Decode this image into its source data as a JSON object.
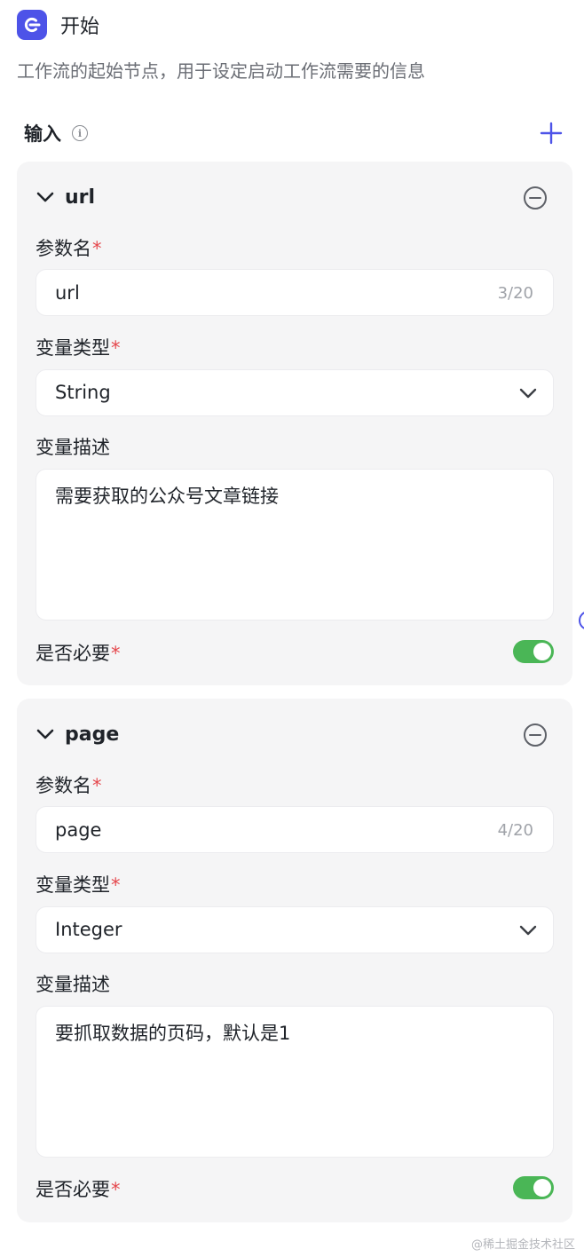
{
  "header": {
    "title": "开始",
    "logo_icon": "start-node-icon",
    "logo_color": "#4d53e8"
  },
  "description": "工作流的起始节点，用于设定启动工作流需要的信息",
  "inputs": {
    "label": "输入",
    "info_icon": "i",
    "add_icon": "plus-icon"
  },
  "params": [
    {
      "name": "url",
      "name_label": "参数名",
      "name_value": "url",
      "name_counter": "3/20",
      "type_label": "变量类型",
      "type_value": "String",
      "desc_label": "变量描述",
      "desc_value": "需要获取的公众号文章链接",
      "required_label": "是否必要",
      "required": true
    },
    {
      "name": "page",
      "name_label": "参数名",
      "name_value": "page",
      "name_counter": "4/20",
      "type_label": "变量类型",
      "type_value": "Integer",
      "desc_label": "变量描述",
      "desc_value": "要抓取数据的页码，默认是1",
      "required_label": "是否必要",
      "required": true
    }
  ],
  "required_mark": "*",
  "watermark": "@稀土掘金技术社区",
  "colors": {
    "accent": "#4d53e8",
    "toggle_on": "#4ab656",
    "required": "#e5484d"
  }
}
